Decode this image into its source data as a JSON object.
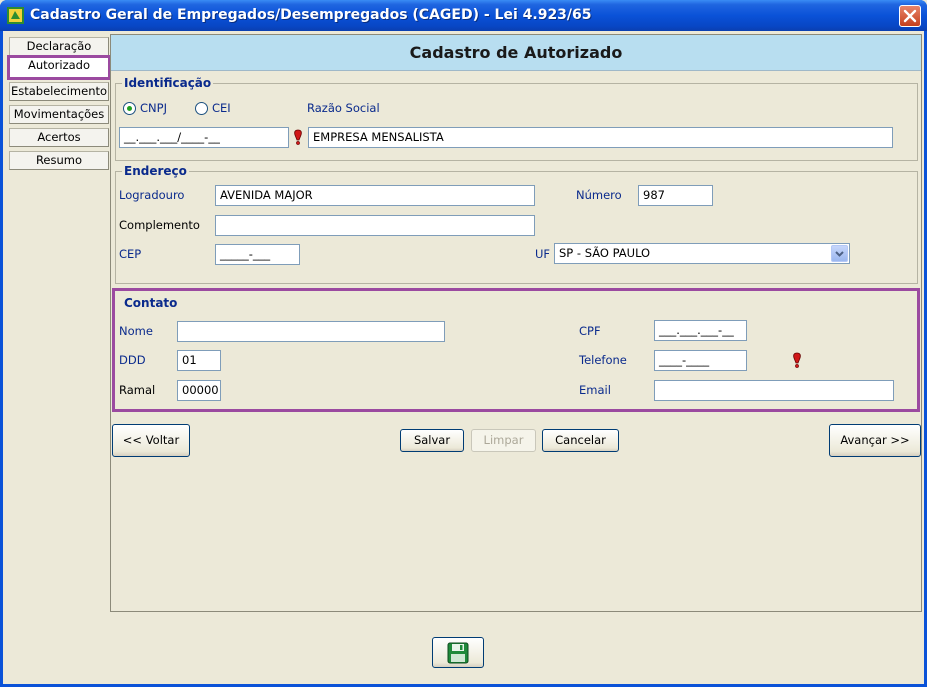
{
  "window": {
    "title": "Cadastro Geral de Empregados/Desempregados (CAGED) - Lei 4.923/65"
  },
  "nav": {
    "items": [
      {
        "label": "Declaração"
      },
      {
        "label": "Autorizado"
      },
      {
        "label": "Estabelecimento"
      },
      {
        "label": "Movimentações"
      },
      {
        "label": "Acertos"
      },
      {
        "label": "Resumo"
      }
    ],
    "active": "Autorizado"
  },
  "header": {
    "title": "Cadastro de Autorizado"
  },
  "identificacao": {
    "legend": "Identificação",
    "radio_cnpj": "CNPJ",
    "radio_cei": "CEI",
    "selected": "CNPJ",
    "razao_social_label": "Razão Social",
    "cnpj_value": "__.___.___/____-__",
    "razao_social_value": "EMPRESA MENSALISTA"
  },
  "endereco": {
    "legend": "Endereço",
    "logradouro_label": "Logradouro",
    "logradouro_value": "AVENIDA MAJOR",
    "numero_label": "Número",
    "numero_value": "987",
    "complemento_label": "Complemento",
    "complemento_value": "",
    "cep_label": "CEP",
    "cep_value": "_____-___",
    "uf_label": "UF",
    "uf_value": "SP - SÃO PAULO"
  },
  "contato": {
    "legend": "Contato",
    "nome_label": "Nome",
    "nome_value": "",
    "cpf_label": "CPF",
    "cpf_value": "___.___.___-__",
    "ddd_label": "DDD",
    "ddd_value": "01",
    "telefone_label": "Telefone",
    "telefone_value": "____-____",
    "ramal_label": "Ramal",
    "ramal_value": "00000",
    "email_label": "Email",
    "email_value": ""
  },
  "buttons": {
    "voltar": "<< Voltar",
    "salvar": "Salvar",
    "limpar": "Limpar",
    "cancelar": "Cancelar",
    "avancar": "Avançar >>"
  },
  "colors": {
    "highlight": "#9b4aa0",
    "header_bg": "#b8def0",
    "label_blue": "#0a2a8c"
  },
  "icons": {
    "app": "caged-app-icon",
    "required": "required-field-icon",
    "save": "floppy-disk-icon",
    "close": "close-icon"
  }
}
